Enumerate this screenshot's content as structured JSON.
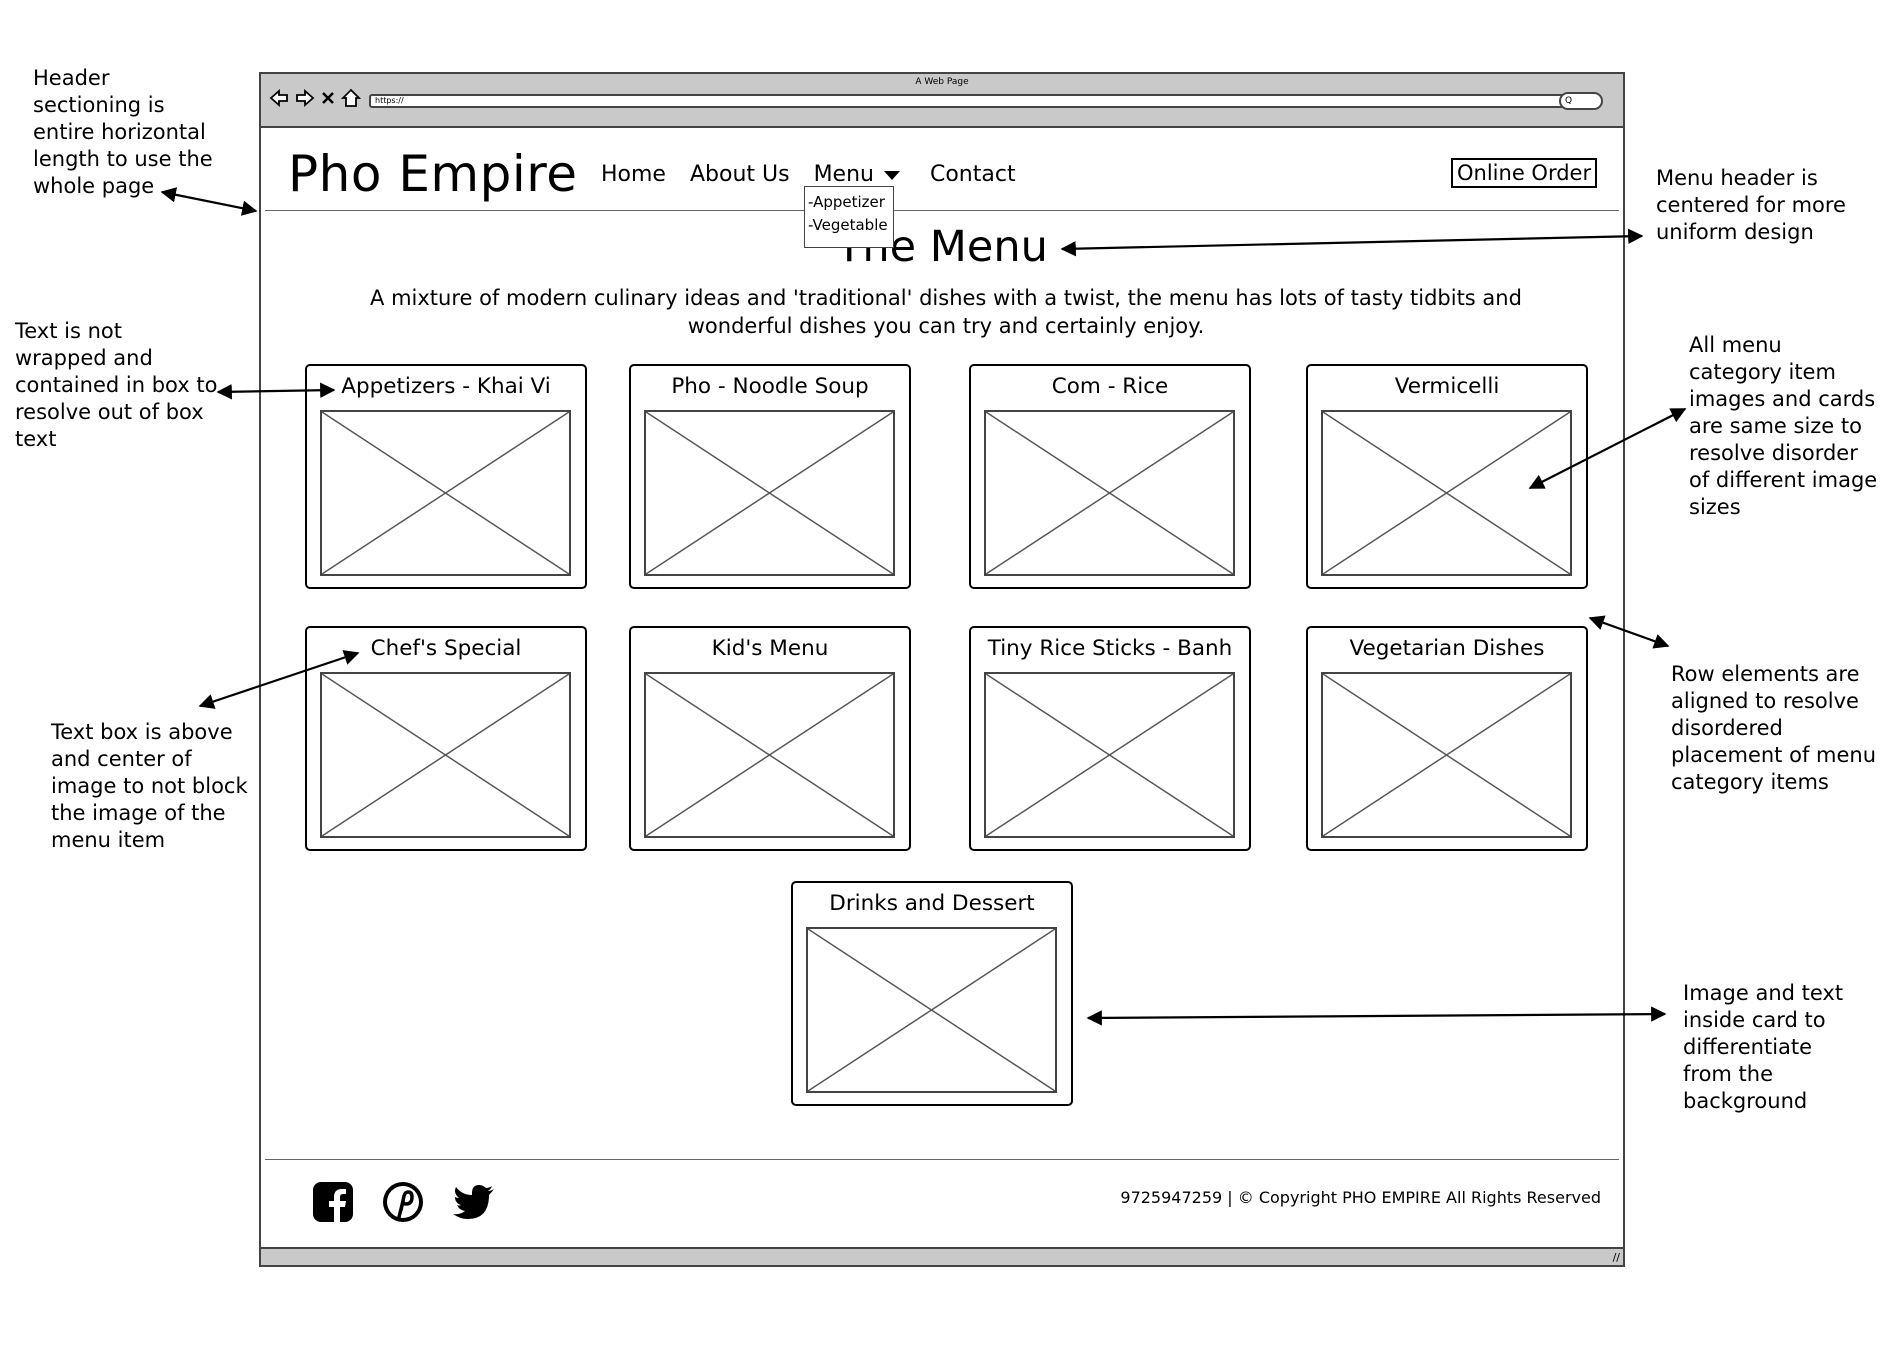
{
  "browser": {
    "window_title": "A Web Page",
    "url": "https://",
    "search_glyph": "Q",
    "resize_glyph": "//"
  },
  "site": {
    "logo": "Pho Empire",
    "nav": {
      "home": "Home",
      "about": "About Us",
      "menu": "Menu",
      "contact": "Contact"
    },
    "dropdown": [
      "-Appetizer",
      "-Vegetable"
    ],
    "online_order": "Online Order"
  },
  "main": {
    "title": "The Menu",
    "description": "A mixture of modern culinary ideas and 'traditional' dishes with a twist, the menu has lots of tasty tidbits and wonderful dishes you can try and certainly enjoy.",
    "cards": [
      "Appetizers - Khai Vi",
      "Pho - Noodle Soup",
      "Com - Rice",
      "Vermicelli",
      "Chef's Special",
      "Kid's Menu",
      "Tiny Rice Sticks - Banh",
      "Vegetarian Dishes",
      "Drinks and Dessert"
    ]
  },
  "footer": {
    "social_icons": [
      "facebook-icon",
      "pinterest-icon",
      "twitter-icon"
    ],
    "text": "9725947259 | © Copyright PHO EMPIRE All Rights Reserved"
  },
  "annotations": {
    "header_section": [
      "Header",
      "sectioning is",
      "entire horizontal",
      "length to use the",
      "whole page"
    ],
    "text_wrap": [
      "Text is not",
      "wrapped and",
      "contained in box to",
      "resolve out of box",
      "text"
    ],
    "text_box": [
      "Text box is above",
      "and center of",
      "image to not block",
      "the image of the",
      "menu item"
    ],
    "menu_header": [
      "Menu header is",
      "centered for more",
      "uniform design"
    ],
    "card_size": [
      "All menu",
      "category item",
      "images and cards",
      "are same size to",
      "resolve disorder",
      "of different image",
      "sizes"
    ],
    "row_align": [
      "Row elements are",
      "aligned to resolve",
      "disordered",
      "placement of menu",
      "category items"
    ],
    "image_text": [
      "Image and text",
      "inside card to",
      "differentiate",
      "from the",
      "background"
    ]
  }
}
